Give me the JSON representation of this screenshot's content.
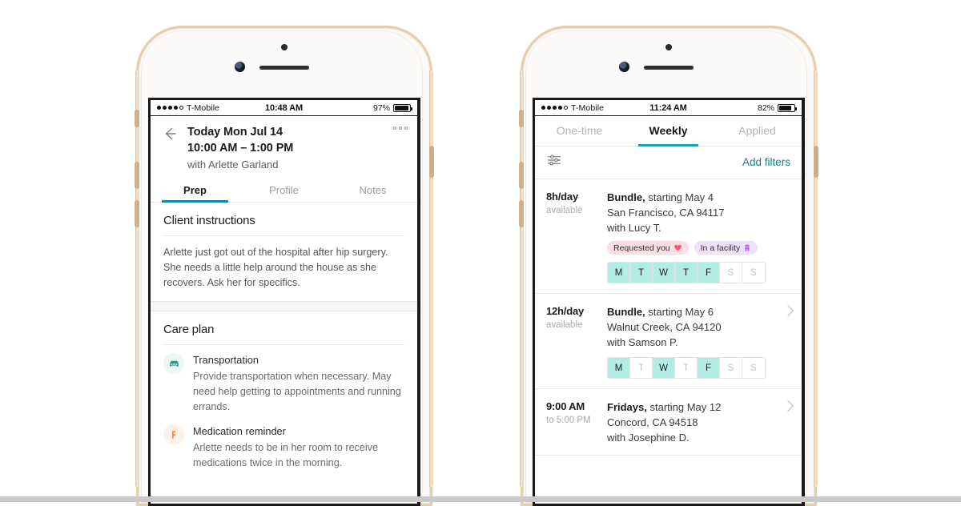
{
  "left_phone": {
    "status_bar": {
      "signal_dots_filled": 4,
      "signal_dots_total": 5,
      "carrier": "T-Mobile",
      "time": "10:48 AM",
      "battery_percent": "97%",
      "battery_level": 97
    },
    "nav": {
      "back_icon": "back-arrow-icon",
      "more_icon": "more-options-icon"
    },
    "appointment": {
      "title": "Today Mon Jul 14",
      "time_range": "10:00 AM – 1:00 PM",
      "with_client": "with Arlette Garland"
    },
    "tabs": [
      {
        "label": "Prep",
        "active": true
      },
      {
        "label": "Profile",
        "active": false
      },
      {
        "label": "Notes",
        "active": false
      }
    ],
    "client_instructions": {
      "title": "Client instructions",
      "body": "Arlette just got out of the hospital after hip surgery. She needs a little help around the house as she recovers. Ask her for specifics."
    },
    "care_plan": {
      "title": "Care plan",
      "items": [
        {
          "icon": "car-icon",
          "name": "Transportation",
          "description": "Provide transportation when necessary. May need help getting to appointments and running errands."
        },
        {
          "icon": "medication-icon",
          "name": "Medication reminder",
          "description": "Arlette needs to be in her room to receive medications twice in the morning."
        }
      ]
    }
  },
  "right_phone": {
    "status_bar": {
      "signal_dots_filled": 4,
      "signal_dots_total": 5,
      "carrier": "T-Mobile",
      "time": "11:24 AM",
      "battery_percent": "82%",
      "battery_level": 82
    },
    "tabs": [
      {
        "label": "One-time",
        "active": false
      },
      {
        "label": "Weekly",
        "active": true
      },
      {
        "label": "Applied",
        "active": false
      }
    ],
    "filter_bar": {
      "filter_icon": "sliders-icon",
      "add_filters_label": "Add filters"
    },
    "jobs": [
      {
        "duration": "8h/day",
        "availability": "available",
        "title_bold": "Bundle,",
        "title_rest": " starting May 4",
        "location": "San Francisco, CA 94117",
        "with_client": "with Lucy T.",
        "badges": [
          {
            "label": "Requested you",
            "icon": "heart-icon",
            "style": "pink"
          },
          {
            "label": "In a facility",
            "icon": "building-icon",
            "style": "lav"
          }
        ],
        "days": [
          {
            "label": "M",
            "on": true
          },
          {
            "label": "T",
            "on": true
          },
          {
            "label": "W",
            "on": true
          },
          {
            "label": "T",
            "on": true
          },
          {
            "label": "F",
            "on": true
          },
          {
            "label": "S",
            "on": false
          },
          {
            "label": "S",
            "on": false
          }
        ],
        "has_chevron": false
      },
      {
        "duration": "12h/day",
        "availability": "available",
        "title_bold": "Bundle,",
        "title_rest": " starting May 6",
        "location": "Walnut Creek, CA 94120",
        "with_client": "with Samson P.",
        "badges": [],
        "days": [
          {
            "label": "M",
            "on": true
          },
          {
            "label": "T",
            "on": false
          },
          {
            "label": "W",
            "on": true
          },
          {
            "label": "T",
            "on": false
          },
          {
            "label": "F",
            "on": true
          },
          {
            "label": "S",
            "on": false
          },
          {
            "label": "S",
            "on": false
          }
        ],
        "has_chevron": true
      },
      {
        "duration": "9:00 AM",
        "availability": "to 5:00 PM",
        "title_bold": "Fridays,",
        "title_rest": " starting May 12",
        "location": "Concord, CA 94518",
        "with_client": "with Josephine D.",
        "badges": [],
        "days": [],
        "has_chevron": true
      }
    ]
  },
  "colors": {
    "teal_accent": "#158a9e",
    "teal_link": "#147f93",
    "day_active": "#b3ece5",
    "badge_pink": "#fcdde4",
    "badge_lavender": "#f0dffa",
    "heart": "#f9566f",
    "building": "#b35cd8",
    "care_car": "#1f9c8e",
    "care_med": "#f08a4b"
  }
}
